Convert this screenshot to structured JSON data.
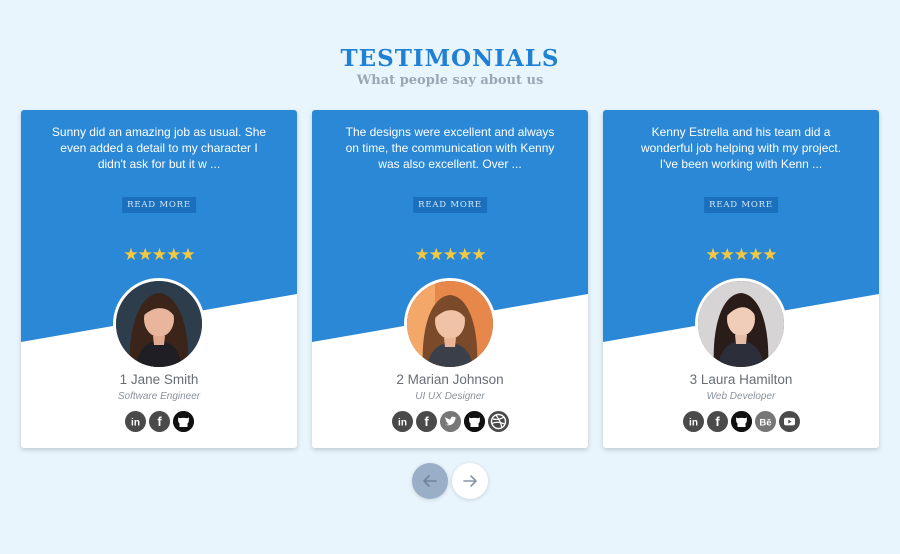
{
  "header": {
    "title": "TESTIMONIALS",
    "subtitle": "What people say about us"
  },
  "cards": [
    {
      "quote": "Sunny did an amazing job as usual. She even added a detail to my character I didn't ask for but it w ...",
      "read_more": "READ MORE",
      "rating": 5,
      "stars": "★★★★★",
      "name": "1 Jane Smith",
      "role": "Software Engineer",
      "avatar_icon": "person-avatar",
      "socials": [
        "linkedin-icon",
        "facebook-icon",
        "github-icon"
      ]
    },
    {
      "quote": "The designs were excellent and always on time, the communication with Kenny was also excellent. Over ...",
      "read_more": "READ MORE",
      "rating": 5,
      "stars": "★★★★★",
      "name": "2 Marian Johnson",
      "role": "UI UX Designer",
      "avatar_icon": "person-avatar",
      "socials": [
        "linkedin-icon",
        "facebook-icon",
        "twitter-icon",
        "github-icon",
        "dribbble-icon"
      ]
    },
    {
      "quote": "Kenny Estrella and his team did a wonderful job helping with my project. I've been working with Kenn ...",
      "read_more": "READ MORE",
      "rating": 5,
      "stars": "★★★★★",
      "name": "3 Laura Hamilton",
      "role": "Web Developer",
      "avatar_icon": "person-avatar",
      "socials": [
        "linkedin-icon",
        "facebook-icon",
        "github-icon",
        "behance-icon",
        "youtube-icon"
      ]
    }
  ],
  "navigation": {
    "prev_icon": "arrow-left-icon",
    "next_icon": "arrow-right-icon"
  },
  "colors": {
    "background": "#e9f5fd",
    "accent": "#2a88d6",
    "title": "#1f80d4",
    "star": "#f5c842",
    "social": "#4a4a4a"
  }
}
